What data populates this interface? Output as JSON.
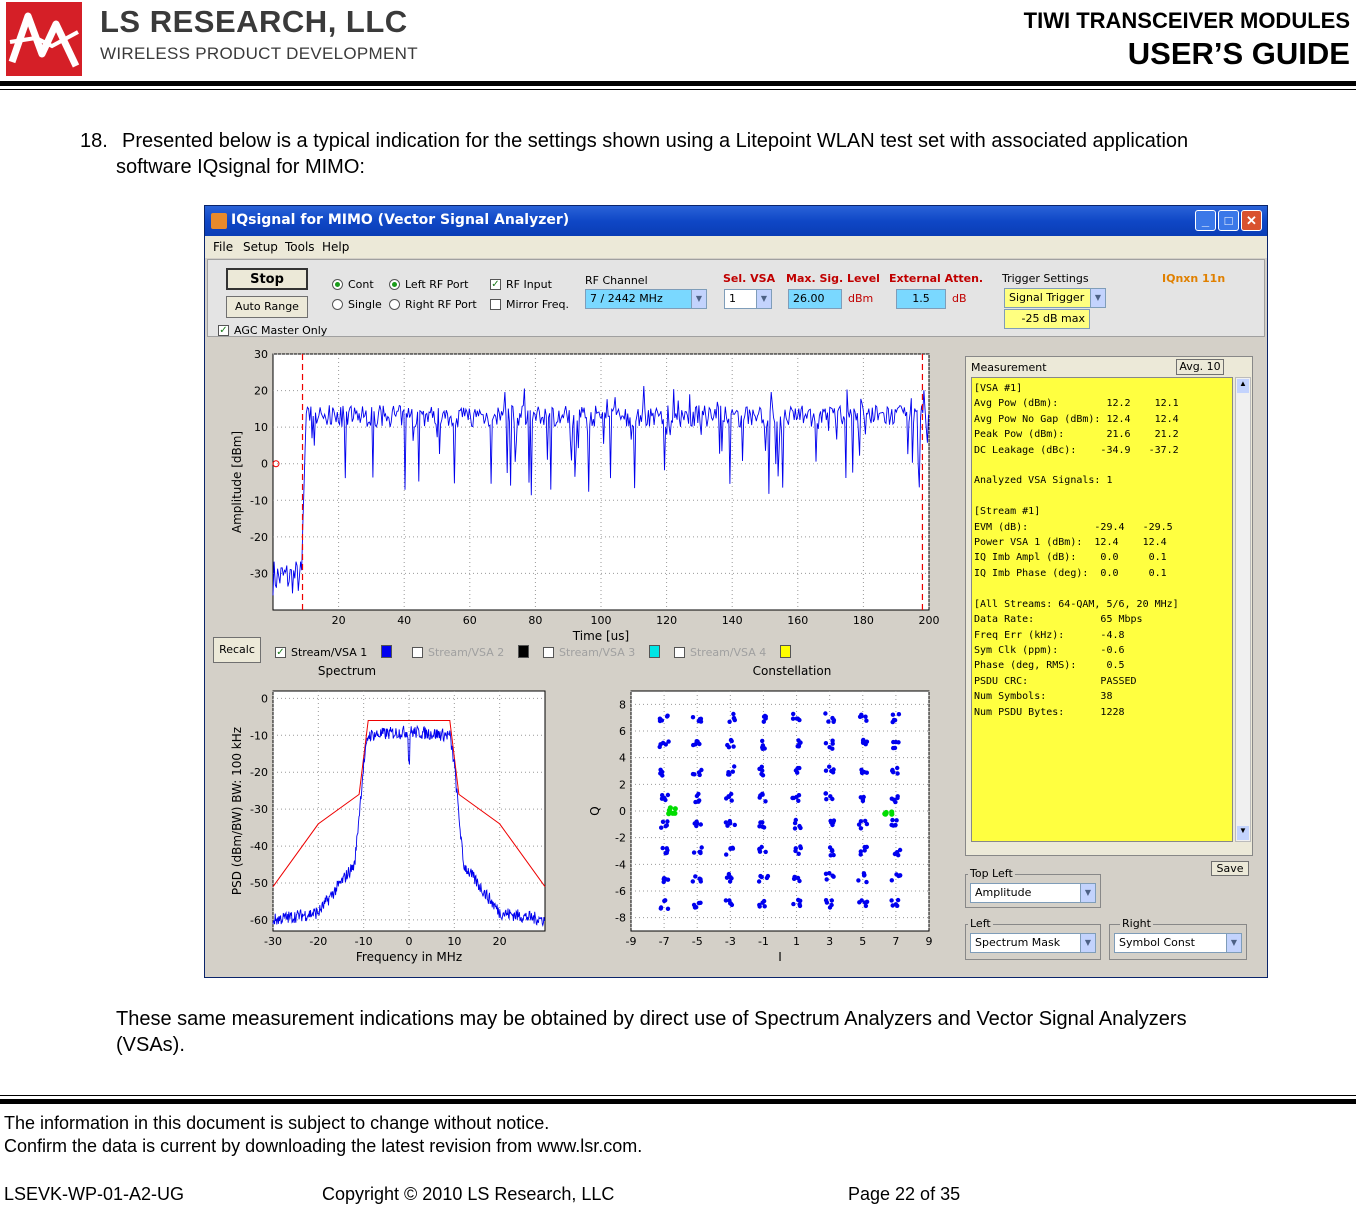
{
  "header": {
    "company": "LS RESEARCH, LLC",
    "company_sub": "WIRELESS PRODUCT DEVELOPMENT",
    "doc_title": "TIWI TRANSCEIVER MODULES",
    "doc_subtitle": "USER’S GUIDE"
  },
  "body": {
    "item_number": "18.",
    "item_text": "Presented below is a typical indication for the settings shown using a Litepoint WLAN test set with associated application",
    "item_text_2": "software IQsignal for MIMO:",
    "closing_1": "These same measurement indications may be obtained by direct use of Spectrum Analyzers and Vector Signal Analyzers",
    "closing_2": "(VSAs)."
  },
  "app": {
    "window_title": "IQsignal for MIMO (Vector Signal Analyzer)",
    "menu": [
      "File",
      "Setup",
      "Tools",
      "Help"
    ],
    "buttons": {
      "stop": "Stop",
      "auto_range": "Auto Range",
      "recalc": "Recalc",
      "avg": "Avg. 10",
      "save": "Save"
    },
    "agc": "AGC Master Only",
    "radio_cont": "Cont",
    "radio_single": "Single",
    "radio_left": "Left RF Port",
    "radio_right": "Right RF Port",
    "chk_rf_input": "RF Input",
    "chk_mirror": "Mirror Freq.",
    "rf_channel_label": "RF Channel",
    "rf_channel_value": "7  /   2442 MHz",
    "sel_vsa_label": "Sel. VSA",
    "sel_vsa_value": "1",
    "max_sig_label": "Max. Sig. Level",
    "max_sig_value": "26.00",
    "max_sig_unit": "dBm",
    "ext_atten_label": "External Atten.",
    "ext_atten_value": "1.5",
    "ext_atten_unit": "dB",
    "trigger_label": "Trigger Settings",
    "trigger_value": "Signal Trigger",
    "trigger_level": "-25 dB max",
    "mode_label": "IQnxn 11n",
    "streams": [
      "Stream/VSA 1",
      "Stream/VSA 2",
      "Stream/VSA 3",
      "Stream/VSA 4"
    ],
    "stream_colors": [
      "#0000ee",
      "#000000",
      "#00e5e5",
      "#ffff00"
    ],
    "spectrum_title": "Spectrum",
    "constellation_title": "Constellation",
    "measurement_label": "Measurement",
    "measurement_text": "[VSA #1]\nAvg Pow (dBm):        12.2    12.1\nAvg Pow No Gap (dBm): 12.4    12.4\nPeak Pow (dBm):       21.6    21.2\nDC Leakage (dBc):    -34.9   -37.2\n\nAnalyzed VSA Signals: 1\n\n[Stream #1]\nEVM (dB):           -29.4   -29.5\nPower VSA 1 (dBm):  12.4    12.4\nIQ Imb Ampl (dB):    0.0     0.1\nIQ Imb Phase (deg):  0.0     0.1\n\n[All Streams: 64-QAM, 5/6, 20 MHz]\nData Rate:           65 Mbps\nFreq Err (kHz):      -4.8\nSym Clk (ppm):       -0.6\nPhase (deg, RMS):     0.5\nPSDU CRC:            PASSED\nNum Symbols:         38\nNum PSDU Bytes:      1228",
    "top_left_label": "Top Left",
    "top_left_value": "Amplitude",
    "left_label": "Left",
    "left_value": "Spectrum Mask",
    "right_label": "Right",
    "right_value": "Symbol Const"
  },
  "chart_data": [
    {
      "type": "line",
      "title": "",
      "xlabel": "Time [us]",
      "ylabel": "Amplitude [dBm]",
      "xlim": [
        0,
        200
      ],
      "ylim": [
        -40,
        30
      ],
      "x_ticks": [
        20,
        40,
        60,
        80,
        100,
        120,
        140,
        160,
        180,
        200
      ],
      "y_ticks": [
        30,
        20,
        10,
        0,
        -10,
        -20,
        -30
      ],
      "grid": true,
      "series": [
        {
          "values_description_only": false,
          "x": [
            0,
            8,
            9,
            10,
            200
          ],
          "values": [
            -31,
            -31,
            -20,
            13,
            13
          ]
        }
      ],
      "markers_x": [
        9,
        198
      ]
    },
    {
      "type": "line",
      "title": "Spectrum",
      "xlabel": "Frequency in MHz",
      "ylabel": "PSD (dBm/BW) BW: 100 kHz",
      "xlim": [
        -30,
        30
      ],
      "ylim": [
        -63,
        2
      ],
      "x_ticks": [
        -30,
        -20,
        -10,
        0,
        10,
        20
      ],
      "y_ticks": [
        0,
        -10,
        -20,
        -30,
        -40,
        -50,
        -60
      ],
      "grid": true,
      "series": [
        {
          "x": [
            -30,
            -20,
            -11,
            -9,
            9,
            11,
            20,
            30
          ],
          "values": [
            -51,
            -34,
            -26,
            -6,
            -6,
            -26,
            -34,
            -51
          ]
        },
        {
          "x": [
            -30,
            -20,
            -12,
            -10,
            -9,
            0,
            9,
            10,
            12,
            20,
            30
          ],
          "values": [
            -60,
            -58,
            -45,
            -18,
            -10,
            -9,
            -10,
            -18,
            -45,
            -58,
            -60
          ]
        }
      ]
    },
    {
      "type": "scatter",
      "title": "Constellation",
      "xlabel": "I",
      "ylabel": "Q",
      "xlim": [
        -9,
        9
      ],
      "ylim": [
        -9,
        9
      ],
      "x_ticks": [
        -9,
        -7,
        -5,
        -3,
        -1,
        1,
        3,
        5,
        7,
        9
      ],
      "y_ticks": [
        8,
        6,
        4,
        2,
        0,
        -2,
        -4,
        -6,
        -8
      ],
      "grid": true,
      "series": [
        {
          "x": [
            -7,
            -5,
            -3,
            -1,
            1,
            3,
            5,
            7
          ],
          "values": [
            7,
            5,
            3,
            1,
            -1,
            -3,
            -5,
            -7
          ],
          "grid_points": true
        },
        {
          "x": [
            -6.5,
            6.5
          ],
          "values": [
            0,
            0
          ]
        }
      ]
    }
  ],
  "footer": {
    "line1": "The information in this document is subject to change without notice.",
    "line2": "Confirm the data is current by downloading the latest revision from www.lsr.com.",
    "doc_id": "LSEVK-WP-01-A2-UG",
    "copyright": "Copyright © 2010 LS Research, LLC",
    "page": "Page 22 of 35"
  }
}
